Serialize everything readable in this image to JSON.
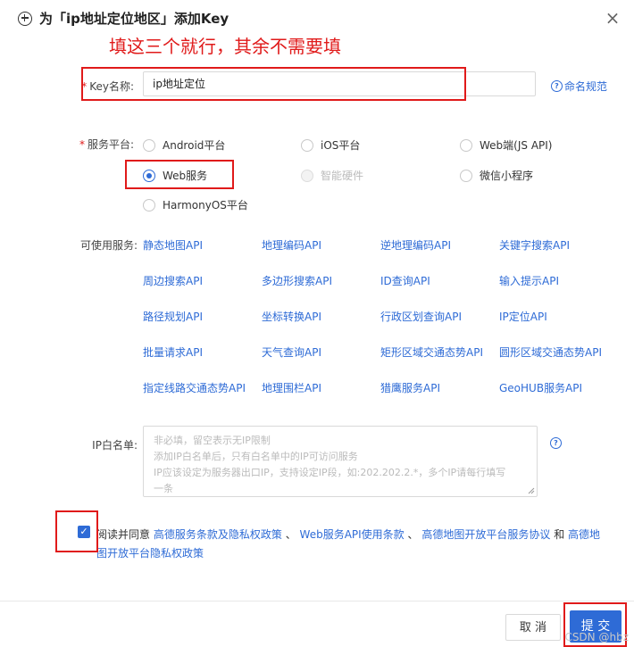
{
  "dialog": {
    "title": "为「ip地址定位地区」添加Key",
    "close": "×"
  },
  "annotation": {
    "text": "填这三个就行，其余不需要填"
  },
  "key_name": {
    "label": "Key名称:",
    "value": "ip地址定位",
    "help_link": "命名规范"
  },
  "platform": {
    "label": "服务平台:",
    "options": [
      {
        "label": "Android平台"
      },
      {
        "label": "iOS平台"
      },
      {
        "label": "Web端(JS API)"
      },
      {
        "label": "Web服务",
        "checked": true
      },
      {
        "label": "智能硬件",
        "disabled": true
      },
      {
        "label": "微信小程序"
      },
      {
        "label": "HarmonyOS平台"
      }
    ]
  },
  "services": {
    "label": "可使用服务:",
    "items": [
      "静态地图API",
      "地理编码API",
      "逆地理编码API",
      "关键字搜索API",
      "周边搜索API",
      "多边形搜索API",
      "ID查询API",
      "输入提示API",
      "路径规划API",
      "坐标转换API",
      "行政区划查询API",
      "IP定位API",
      "批量请求API",
      "天气查询API",
      "矩形区域交通态势API",
      "圆形区域交通态势API",
      "指定线路交通态势API",
      "地理围栏API",
      "猎鹰服务API",
      "GeoHUB服务API"
    ]
  },
  "ip_whitelist": {
    "label": "IP白名单:",
    "placeholder_lines": [
      "非必填，留空表示无IP限制",
      "添加IP白名单后，只有白名单中的IP可访问服务",
      "IP应该设定为服务器出口IP，支持设定IP段，如:202.202.2.*，多个IP请每行填写",
      "一条"
    ]
  },
  "agreement": {
    "checked": true,
    "prefix": "阅读并同意",
    "link1": "高德服务条款及隐私权政策",
    "sep1": "、",
    "link2": "Web服务API使用条款",
    "sep2": "、",
    "link3": "高德地图开放平台服务协议",
    "sep3": "和",
    "link4": "高德地图开放平台隐私权政策"
  },
  "buttons": {
    "cancel": "取 消",
    "submit": "提 交"
  },
  "watermark": "CSDN @hbz",
  "colors": {
    "accent": "#2e6bd6",
    "annotation": "#e01a1a"
  }
}
